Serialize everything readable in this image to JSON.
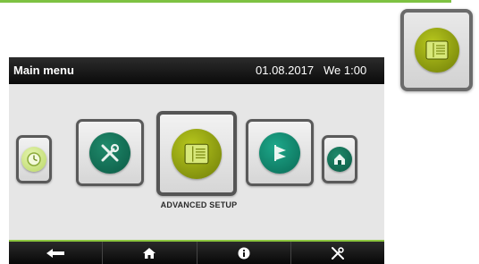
{
  "header": {
    "title": "Main menu",
    "date": "01.08.2017",
    "time": "We 1:00"
  },
  "menu": {
    "selected_caption": "ADVANCED SETUP",
    "items": [
      {
        "icon": "clock-icon"
      },
      {
        "icon": "tools-icon"
      },
      {
        "icon": "advanced-setup-icon"
      },
      {
        "icon": "flag-icon"
      },
      {
        "icon": "house-icon"
      }
    ]
  },
  "bottom_nav": [
    {
      "icon": "back-arrow-icon"
    },
    {
      "icon": "home-icon"
    },
    {
      "icon": "info-icon"
    },
    {
      "icon": "tools-icon"
    }
  ],
  "colors": {
    "accent_green": "#8dc63f",
    "olive": "#9aad13",
    "teal": "#127a5e"
  }
}
